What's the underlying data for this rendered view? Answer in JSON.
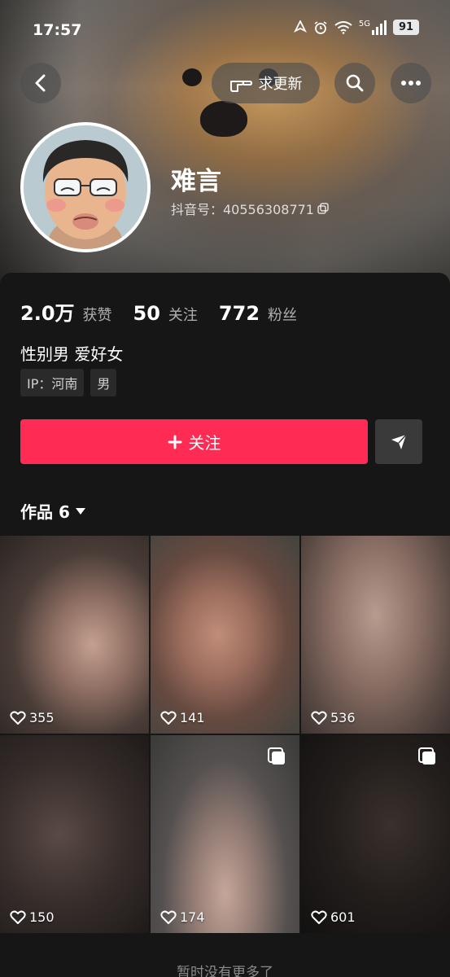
{
  "status_bar": {
    "time": "17:57",
    "signal_label": "5G",
    "battery": "91"
  },
  "header": {
    "update_request_label": "求更新"
  },
  "profile": {
    "name": "难言",
    "douyin_id": "抖音号：40556308771",
    "stats": [
      {
        "value": "2.0万",
        "label": "获赞"
      },
      {
        "value": "50",
        "label": "关注"
      },
      {
        "value": "772",
        "label": "粉丝"
      }
    ],
    "bio": "性别男 爱好女",
    "tags": [
      "IP：河南",
      "男"
    ],
    "follow_label": "关注",
    "works_tab_label": "作品 6"
  },
  "grid": {
    "items": [
      {
        "likes": "355",
        "multi": false
      },
      {
        "likes": "141",
        "multi": false
      },
      {
        "likes": "536",
        "multi": false
      },
      {
        "likes": "150",
        "multi": false
      },
      {
        "likes": "174",
        "multi": true
      },
      {
        "likes": "601",
        "multi": true
      }
    ]
  },
  "footer": {
    "no_more_text": "暂时没有更多了"
  },
  "colors": {
    "follow_button": "#fe2c55",
    "panel_background": "#161616"
  },
  "icons": [
    "back-icon",
    "pointing-hand-icon",
    "search-icon",
    "more-icon",
    "plus-icon",
    "send-icon",
    "heart-icon",
    "multi-image-icon",
    "copy-icon",
    "caret-down-icon"
  ]
}
